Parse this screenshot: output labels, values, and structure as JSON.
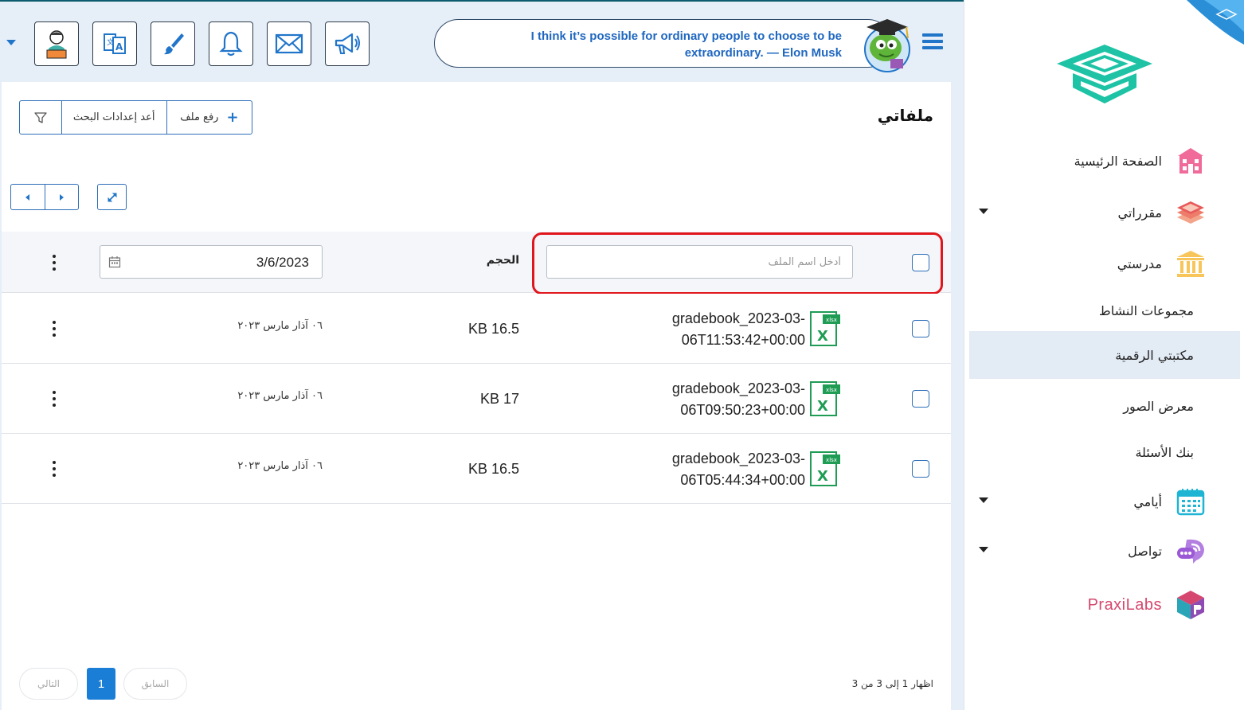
{
  "header": {
    "quote": "I think it’s possible for ordinary people to choose to be extraordinary. — Elon Musk"
  },
  "sidebar": {
    "items": [
      {
        "label": "الصفحة الرئيسية"
      },
      {
        "label": "مقرراتي"
      },
      {
        "label": "مدرستي"
      },
      {
        "label": "مجموعات النشاط"
      },
      {
        "label": "مكتبتي الرقمية"
      },
      {
        "label": "معرض الصور"
      },
      {
        "label": "بنك الأسئلة"
      },
      {
        "label": "أيامي"
      },
      {
        "label": "تواصل"
      }
    ],
    "partner": "PraxiLabs"
  },
  "main": {
    "title": "ملفاتي",
    "upload_label": "رفع ملف",
    "reset_label": "أعد إعدادات البحث",
    "filter": {
      "name_placeholder": "أدخل اسم الملف",
      "size_header": "الحجم",
      "date_value": "3/6/2023"
    },
    "rows": [
      {
        "name": "gradebook_2023-03-06T11:53:42+00:00",
        "ext": "xlsx",
        "size": "KB 16.5",
        "date": "٠٦ آذار مارس ٢٠٢٣"
      },
      {
        "name": "gradebook_2023-03-06T09:50:23+00:00",
        "ext": "xlsx",
        "size": "KB 17",
        "date": "٠٦ آذار مارس ٢٠٢٣"
      },
      {
        "name": "gradebook_2023-03-06T05:44:34+00:00",
        "ext": "xlsx",
        "size": "KB 16.5",
        "date": "٠٦ آذار مارس ٢٠٢٣"
      }
    ],
    "pagination": {
      "info": "اظهار 1 إلى 3 من 3",
      "prev": "السابق",
      "next": "التالي",
      "current": "1"
    }
  },
  "colors": {
    "accent": "#2175c9",
    "highlight": "#e0161d",
    "excel": "#1f9d55"
  }
}
